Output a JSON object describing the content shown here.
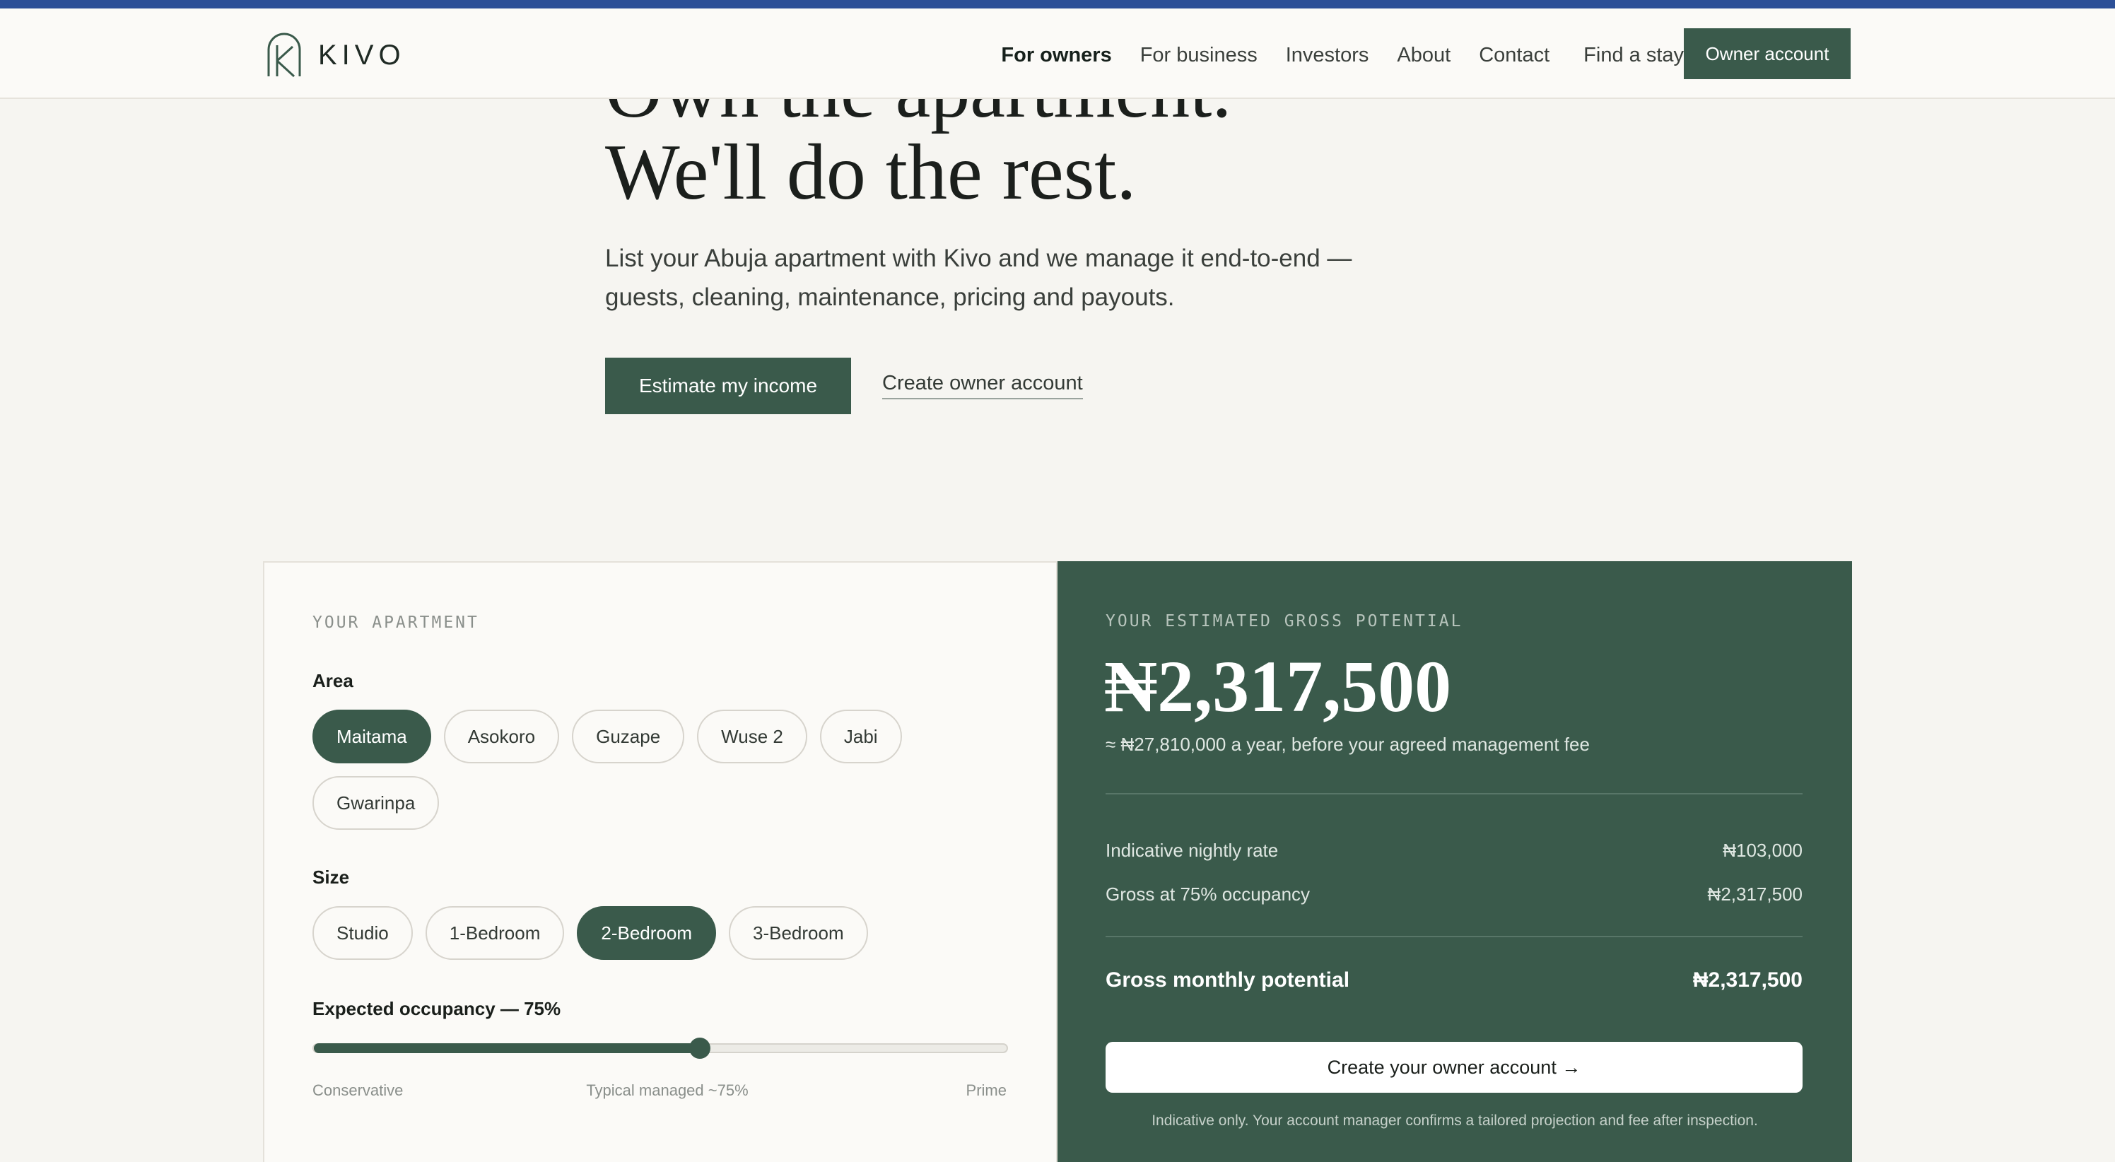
{
  "colors": {
    "brand_green": "#3a5a4b",
    "top_bar": "#2c4f97",
    "page_bg": "#f6f5f1"
  },
  "nav": {
    "logo_text": "KIVO",
    "links": [
      "For owners",
      "For business",
      "Investors",
      "About",
      "Contact",
      "Find a stay"
    ],
    "cta": "Owner account"
  },
  "hero": {
    "title_line1": "Own the apartment.",
    "title_line2": "We'll do the rest.",
    "subtitle": "List your Abuja apartment with Kivo and we manage it end-to-end — guests, cleaning, maintenance, pricing and payouts.",
    "primary_button": "Estimate my income",
    "secondary_link": "Create owner account"
  },
  "calculator": {
    "eyebrow": "YOUR APARTMENT",
    "area_label": "Area",
    "areas": [
      "Maitama",
      "Asokoro",
      "Guzape",
      "Wuse 2",
      "Jabi",
      "Gwarinpa"
    ],
    "selected_area": "Maitama",
    "size_label": "Size",
    "sizes": [
      "Studio",
      "1-Bedroom",
      "2-Bedroom",
      "3-Bedroom"
    ],
    "selected_size": "2-Bedroom",
    "occupancy_label": "Expected occupancy — 75%",
    "occupancy_value": 0.5575,
    "slider_ticks": [
      "Conservative",
      "Typical managed ~75%",
      "Prime"
    ]
  },
  "estimate": {
    "eyebrow": "YOUR ESTIMATED GROSS POTENTIAL",
    "amount": "₦2,317,500",
    "per_year": "≈ ₦27,810,000 a year, before your agreed management fee",
    "rows": [
      {
        "label": "Indicative nightly rate",
        "value": "₦103,000"
      },
      {
        "label": "Gross at 75% occupancy",
        "value": "₦2,317,500"
      }
    ],
    "total_label": "Gross monthly potential",
    "total_value": "₦2,317,500",
    "cta": "Create your owner account →",
    "note": "Indicative only. Your account manager confirms a tailored projection and fee after inspection."
  }
}
